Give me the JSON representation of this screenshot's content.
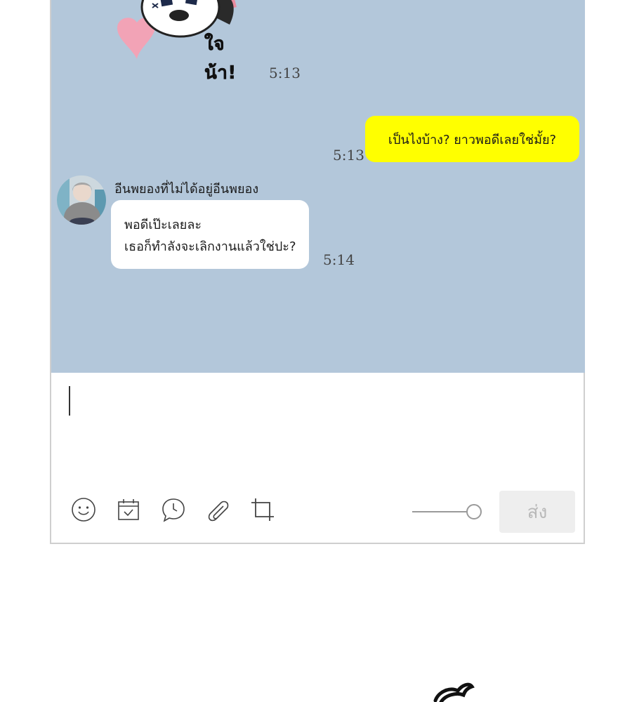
{
  "chat": {
    "sticker": {
      "text": "ใจน้า!",
      "icon": "panda-sticker-icon"
    },
    "messages": [
      {
        "time": "5:13"
      },
      {
        "text": "เป็นไงบ้าง? ยาวพอดีเลยใช่มั้ย?",
        "time": "5:13",
        "from": "me"
      },
      {
        "sender": "อีนพยองที่ไม่ได้อยู่อีนพยอง",
        "lines": [
          "พอดีเป๊ะเลยละ",
          "เธอก็ทำลังจะเลิกงานแล้วใช่ปะ?"
        ],
        "time": "5:14",
        "from": "other"
      }
    ]
  },
  "input": {
    "value": "",
    "toolbar": [
      "emoji-icon",
      "calendar-icon",
      "chat-clock-icon",
      "paperclip-icon",
      "crop-icon"
    ],
    "font_size_slider": 1.0,
    "send_label": "ส่ง"
  },
  "colors": {
    "chat_background": "#b3c7da",
    "my_bubble": "#ffff00",
    "other_bubble": "#ffffff",
    "send_button": "#eeeeee"
  }
}
